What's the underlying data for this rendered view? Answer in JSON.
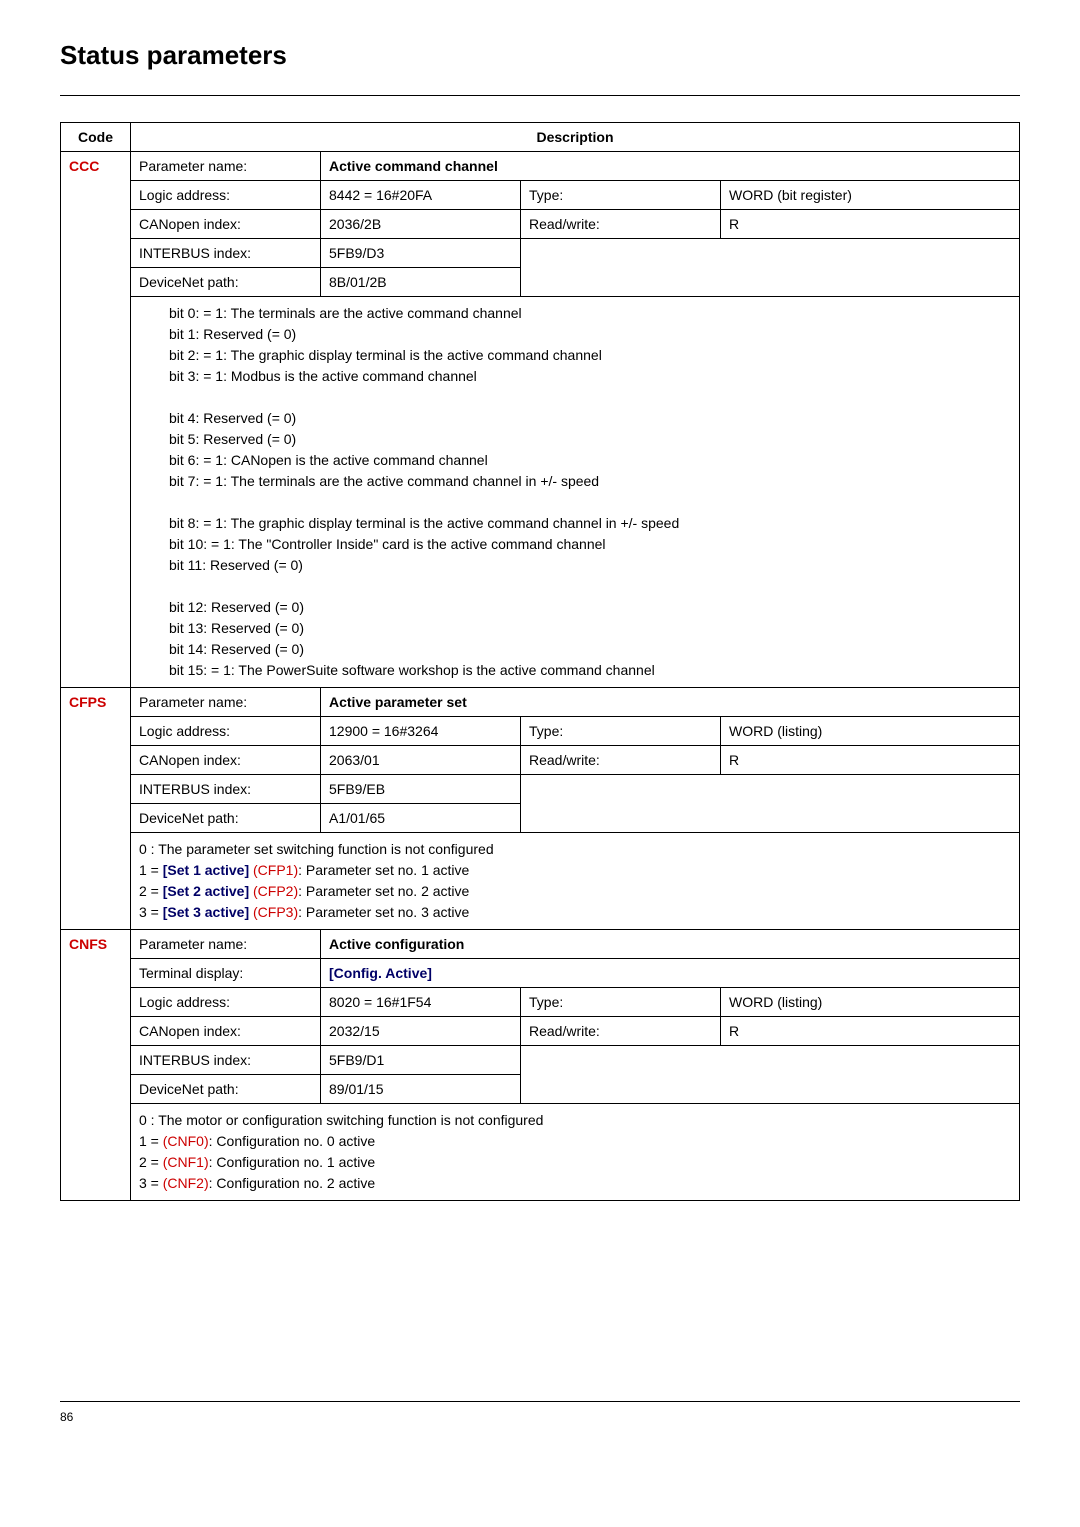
{
  "page": {
    "title": "Status parameters",
    "number": "86"
  },
  "headers": {
    "code": "Code",
    "description": "Description"
  },
  "labels": {
    "param_name": "Parameter name:",
    "logic_addr": "Logic address:",
    "canopen": "CANopen index:",
    "interbus": "INTERBUS index:",
    "devicenet": "DeviceNet path:",
    "type": "Type:",
    "rw": "Read/write:",
    "terminal_display": "Terminal display:"
  },
  "ccc": {
    "code": "CCC",
    "name": "Active command channel",
    "logic_addr": "8442 = 16#20FA",
    "canopen": "2036/2B",
    "interbus": "5FB9/D3",
    "devicenet": "8B/01/2B",
    "type": "WORD (bit register)",
    "rw": "R",
    "bits": {
      "b0": "bit 0: = 1: The terminals are the active command channel",
      "b1": "bit 1: Reserved (= 0)",
      "b2": "bit 2: = 1: The graphic display terminal is the active command channel",
      "b3": "bit 3: = 1: Modbus is the active command channel",
      "b4": "bit 4: Reserved (= 0)",
      "b5": "bit 5: Reserved (= 0)",
      "b6": "bit 6: = 1: CANopen is the active command channel",
      "b7": "bit 7: = 1: The terminals are the active command channel in +/- speed",
      "b8": "bit 8: = 1: The graphic display terminal is the active command channel in +/- speed",
      "b10": "bit 10: = 1: The \"Controller Inside\" card is the active command channel",
      "b11": "bit 11: Reserved (= 0)",
      "b12": "bit 12: Reserved (= 0)",
      "b13": "bit 13: Reserved (= 0)",
      "b14": "bit 14: Reserved (= 0)",
      "b15": "bit 15: = 1: The PowerSuite software workshop is the active command channel"
    }
  },
  "cfps": {
    "code": "CFPS",
    "name": "Active parameter set",
    "logic_addr": "12900 = 16#3264",
    "canopen": "2063/01",
    "interbus": "5FB9/EB",
    "devicenet": "A1/01/65",
    "type": "WORD (listing)",
    "rw": "R",
    "desc": {
      "line0": "0 : The parameter set switching function is not configured",
      "p1a": "1 = ",
      "p1b": "[Set 1 active]",
      "p1c": " (CFP1)",
      "p1d": ": Parameter set no. 1 active",
      "p2a": "2 = ",
      "p2b": "[Set 2 active]",
      "p2c": " (CFP2)",
      "p2d": ": Parameter set no. 2 active",
      "p3a": "3 = ",
      "p3b": "[Set 3 active]",
      "p3c": " (CFP3)",
      "p3d": ": Parameter set no. 3 active"
    }
  },
  "cnfs": {
    "code": "CNFS",
    "name": "Active configuration",
    "terminal_display": "[Config. Active]",
    "logic_addr": "8020 = 16#1F54",
    "canopen": "2032/15",
    "interbus": "5FB9/D1",
    "devicenet": "89/01/15",
    "type": "WORD (listing)",
    "rw": "R",
    "desc": {
      "line0": "0 : The motor or configuration switching function is not configured",
      "p1a": "1 = ",
      "p1b": "(CNF0)",
      "p1c": ": Configuration no. 0 active",
      "p2a": "2 = ",
      "p2b": "(CNF1)",
      "p2c": ": Configuration no. 1 active",
      "p3a": "3 = ",
      "p3b": "(CNF2)",
      "p3c": ": Configuration no. 2 active"
    }
  }
}
